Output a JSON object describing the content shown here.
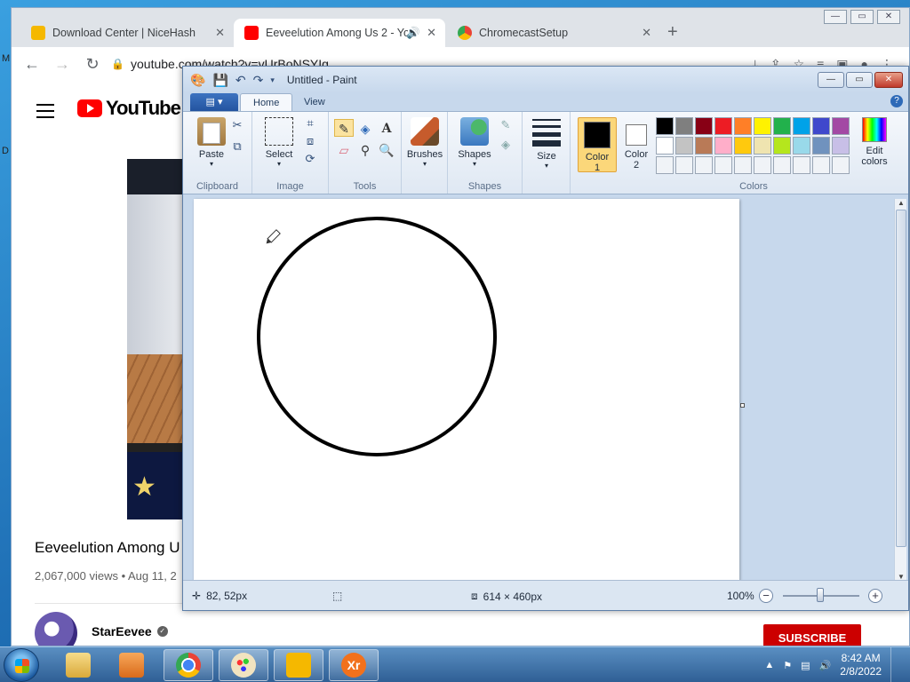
{
  "browser": {
    "tabs": [
      {
        "title": "Download Center | NiceHash",
        "favicon_color": "#f5b800"
      },
      {
        "title": "Eeveelution Among Us 2 - Yo",
        "favicon_color": "#ff0000",
        "active": true
      },
      {
        "title": "ChromecastSetup",
        "favicon_color": "#4285f4"
      }
    ],
    "url": "youtube.com/watch?v=vUrBoNSYIg",
    "close_glyph": "✕",
    "new_tab_glyph": "+"
  },
  "youtube": {
    "logo_text": "YouTube",
    "video_title": "Eeveelution Among U",
    "meta": "2,067,000 views • Aug 11, 2",
    "channel": "StarEevee",
    "subscribe": "SUBSCRIBE",
    "side_chars": [
      "M",
      "D"
    ]
  },
  "paint": {
    "window_title": "Untitled - Paint",
    "tabs": {
      "home": "Home",
      "view": "View"
    },
    "groups": {
      "clipboard": "Clipboard",
      "image": "Image",
      "tools": "Tools",
      "shapes": "Shapes",
      "colors": "Colors"
    },
    "buttons": {
      "paste": "Paste",
      "select": "Select",
      "brushes": "Brushes",
      "shapes": "Shapes",
      "size": "Size",
      "color1_line1": "Color",
      "color1_line2": "1",
      "color2_line1": "Color",
      "color2_line2": "2",
      "edit_colors_line1": "Edit",
      "edit_colors_line2": "colors"
    },
    "color1": "#000000",
    "color2": "#ffffff",
    "palette": [
      "#000000",
      "#7f7f7f",
      "#880015",
      "#ed1c24",
      "#ff7f27",
      "#fff200",
      "#22b14c",
      "#00a2e8",
      "#3f48cc",
      "#a349a4",
      "#ffffff",
      "#c3c3c3",
      "#b97a57",
      "#ffaec9",
      "#ffc90e",
      "#efe4b0",
      "#b5e61d",
      "#99d9ea",
      "#7092be",
      "#c8bfe7",
      "#f0f3f7",
      "#f0f3f7",
      "#f0f3f7",
      "#f0f3f7",
      "#f0f3f7",
      "#f0f3f7",
      "#f0f3f7",
      "#f0f3f7",
      "#f0f3f7",
      "#f0f3f7"
    ],
    "status": {
      "cursor_pos": "82, 52px",
      "canvas_size": "614 × 460px",
      "zoom": "100%"
    }
  },
  "taskbar": {
    "time": "8:42 AM",
    "date": "2/8/2022"
  }
}
